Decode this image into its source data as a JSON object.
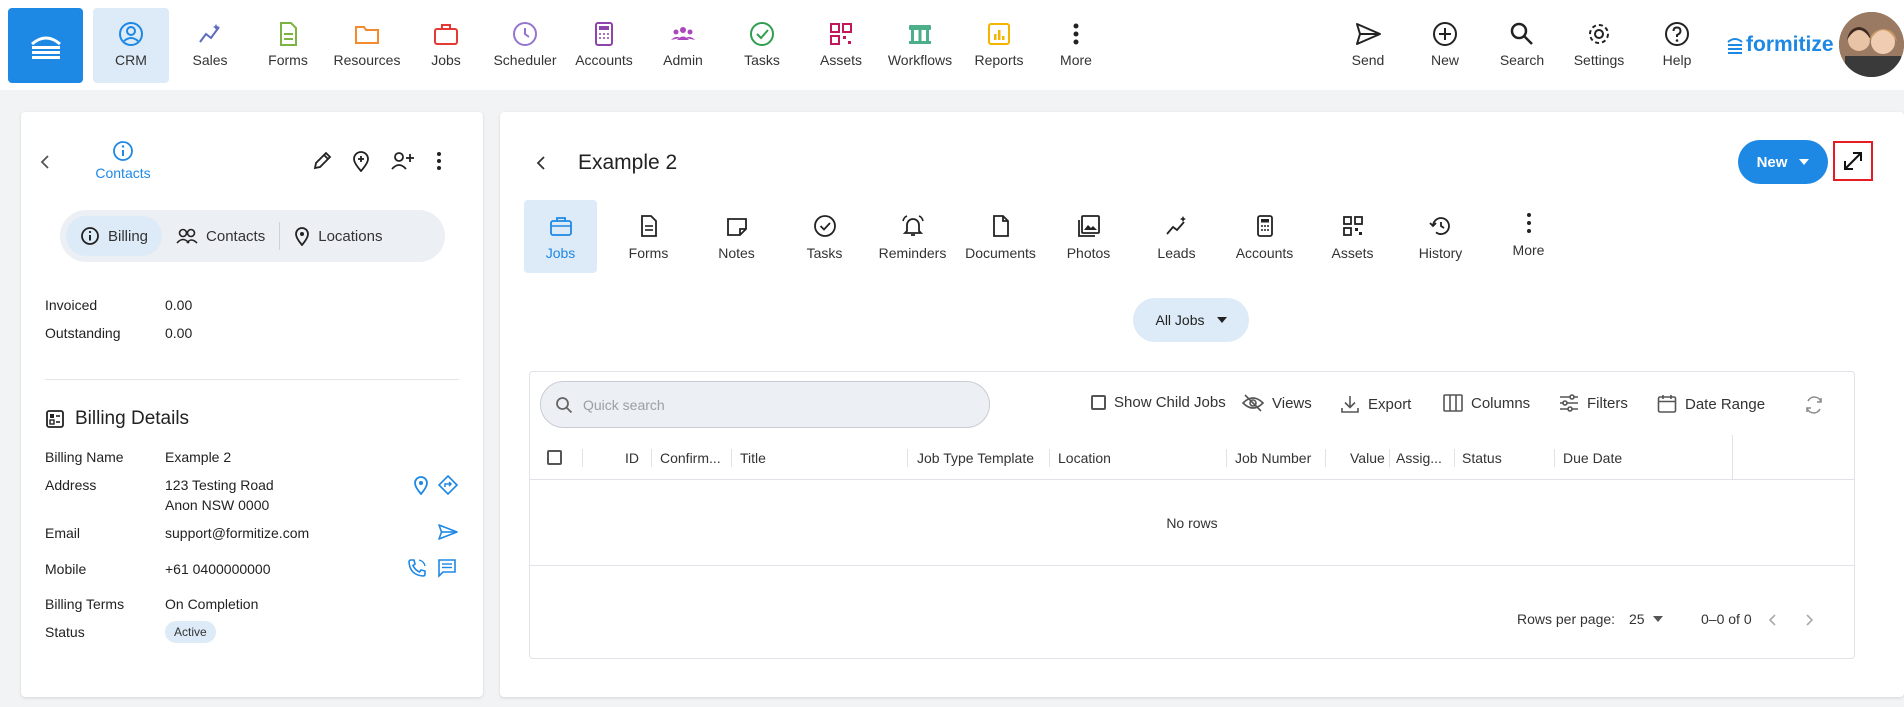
{
  "topnav": {
    "items": [
      {
        "label": "CRM",
        "icon": "crm-icon",
        "active": true
      },
      {
        "label": "Sales",
        "icon": "sales-icon"
      },
      {
        "label": "Forms",
        "icon": "forms-icon"
      },
      {
        "label": "Resources",
        "icon": "resources-icon"
      },
      {
        "label": "Jobs",
        "icon": "jobs-icon"
      },
      {
        "label": "Scheduler",
        "icon": "scheduler-icon"
      },
      {
        "label": "Accounts",
        "icon": "accounts-icon"
      },
      {
        "label": "Admin",
        "icon": "admin-icon"
      },
      {
        "label": "Tasks",
        "icon": "tasks-icon"
      },
      {
        "label": "Assets",
        "icon": "assets-icon"
      },
      {
        "label": "Workflows",
        "icon": "workflows-icon"
      },
      {
        "label": "Reports",
        "icon": "reports-icon"
      },
      {
        "label": "More",
        "icon": "more-icon"
      }
    ],
    "right_items": [
      {
        "label": "Send",
        "icon": "send-icon"
      },
      {
        "label": "New",
        "icon": "plus-circle-icon"
      },
      {
        "label": "Search",
        "icon": "search-icon"
      },
      {
        "label": "Settings",
        "icon": "gear-icon"
      },
      {
        "label": "Help",
        "icon": "help-icon"
      }
    ],
    "brand": "formitize",
    "colors": {
      "primary": "#1e88e5",
      "active_bg": "#dcebf7"
    }
  },
  "left": {
    "contacts_label": "Contacts",
    "segments": [
      {
        "label": "Billing",
        "icon": "info-icon",
        "active": true
      },
      {
        "label": "Contacts",
        "icon": "people-icon"
      },
      {
        "label": "Locations",
        "icon": "location-pin-icon"
      }
    ],
    "invoiced_label": "Invoiced",
    "invoiced_value": "0.00",
    "outstanding_label": "Outstanding",
    "outstanding_value": "0.00",
    "billing_details_title": "Billing Details",
    "billing_name_label": "Billing Name",
    "billing_name_value": "Example 2",
    "address_label": "Address",
    "address_line1": "123 Testing Road",
    "address_line2": "Anon NSW 0000",
    "email_label": "Email",
    "email_value": "support@formitize.com",
    "mobile_label": "Mobile",
    "mobile_value": "+61 0400000000",
    "billing_terms_label": "Billing Terms",
    "billing_terms_value": "On Completion",
    "status_label": "Status",
    "status_value": "Active"
  },
  "right": {
    "title": "Example 2",
    "new_button": "New",
    "tabs": [
      {
        "label": "Jobs",
        "icon": "briefcase-icon",
        "active": true
      },
      {
        "label": "Forms",
        "icon": "form-icon"
      },
      {
        "label": "Notes",
        "icon": "notes-icon"
      },
      {
        "label": "Tasks",
        "icon": "check-circle-icon"
      },
      {
        "label": "Reminders",
        "icon": "alarm-icon"
      },
      {
        "label": "Documents",
        "icon": "document-icon"
      },
      {
        "label": "Photos",
        "icon": "photos-icon"
      },
      {
        "label": "Leads",
        "icon": "leads-icon"
      },
      {
        "label": "Accounts",
        "icon": "calculator-icon"
      },
      {
        "label": "Assets",
        "icon": "qr-icon"
      },
      {
        "label": "History",
        "icon": "history-icon"
      },
      {
        "label": "More",
        "icon": "more-vert-icon"
      }
    ],
    "filter": "All Jobs",
    "search_placeholder": "Quick search",
    "toolbar": {
      "show_child_jobs": "Show Child Jobs",
      "views": "Views",
      "export": "Export",
      "columns": "Columns",
      "filters": "Filters",
      "date_range": "Date Range"
    },
    "columns": [
      "ID",
      "Confirm...",
      "Title",
      "Job Type Template",
      "Location",
      "Job Number",
      "Value",
      "Assig...",
      "Status",
      "Due Date"
    ],
    "empty_text": "No rows",
    "rows_per_page_label": "Rows per page:",
    "rows_per_page_value": "25",
    "page_range": "0–0 of 0"
  }
}
